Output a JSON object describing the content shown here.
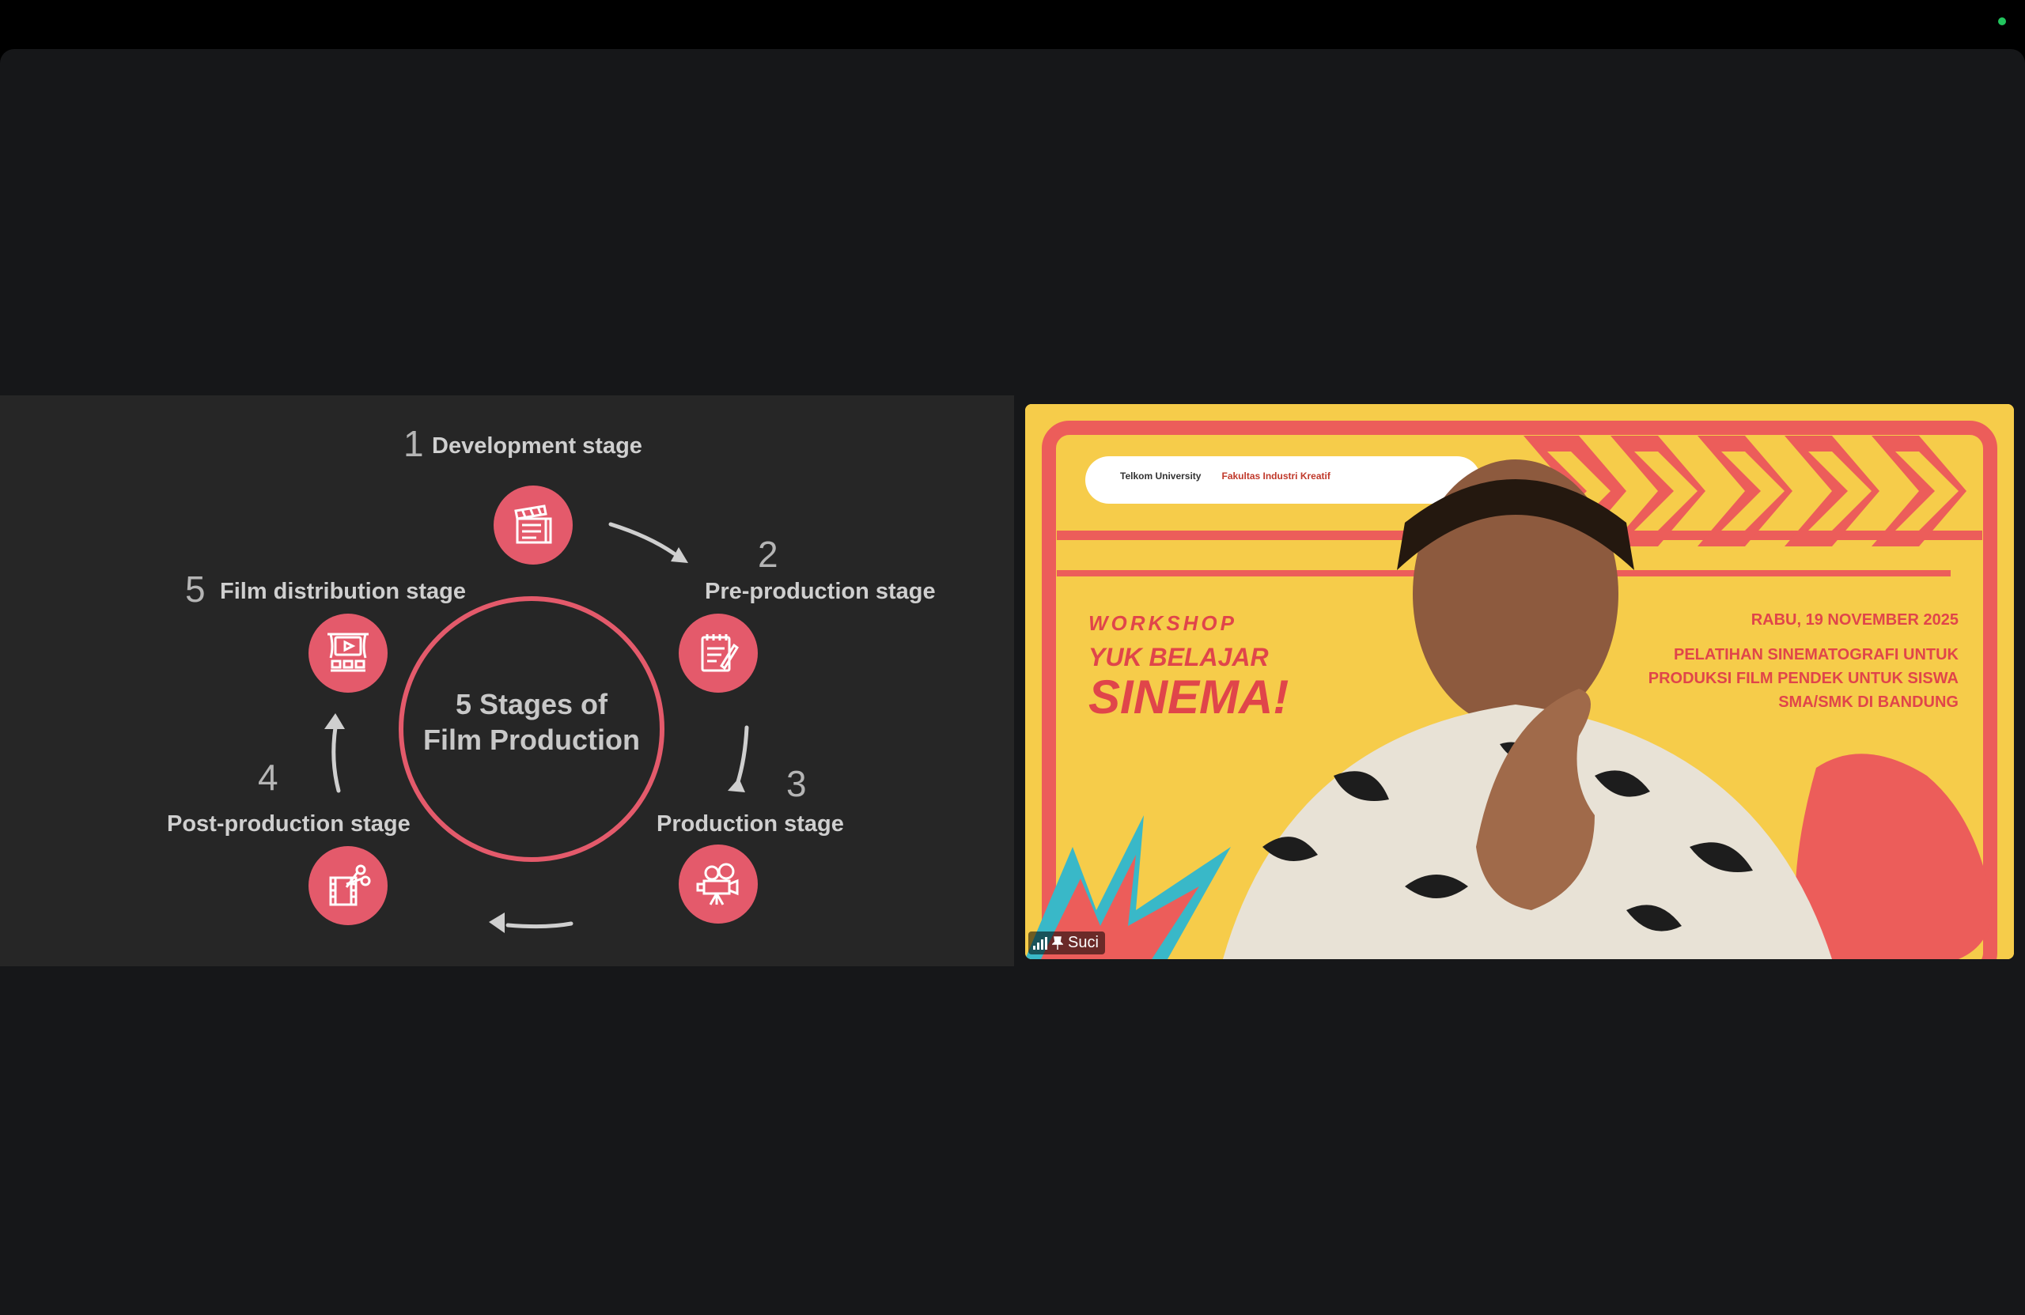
{
  "window": {
    "status_indicator": "green"
  },
  "slide": {
    "title_line1": "5 Stages of",
    "title_line2": "Film Production",
    "accent_color": "#e45a6b",
    "stages": [
      {
        "number": "1",
        "label": "Development stage",
        "icon": "clapperboard-icon"
      },
      {
        "number": "2",
        "label": "Pre-production stage",
        "icon": "script-icon"
      },
      {
        "number": "3",
        "label": "Production stage",
        "icon": "film-camera-icon"
      },
      {
        "number": "4",
        "label": "Post-production stage",
        "icon": "film-editing-icon"
      },
      {
        "number": "5",
        "label": "Film distribution stage",
        "icon": "cinema-screen-icon"
      }
    ]
  },
  "video": {
    "participant_name": "Suci",
    "banner": {
      "logos": [
        "Telkom University",
        "Fakultas Industri Kreatif"
      ],
      "workshop_label": "WORKSHOP",
      "headline_line1": "YUK BELAJAR",
      "headline_line2": "SINEMA!",
      "date": "RABU, 19 NOVEMBER 2025",
      "description_line1": "PELATIHAN SINEMATOGRAFI UNTUK",
      "description_line2": "PRODUKSI FILM PENDEK UNTUK SISWA",
      "description_line3": "SMA/SMK DI BANDUNG"
    }
  }
}
